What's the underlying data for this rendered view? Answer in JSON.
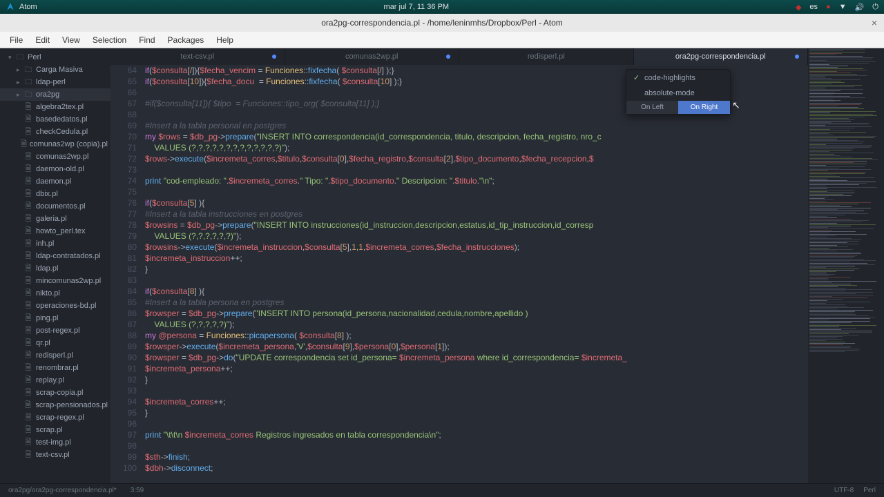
{
  "topbar": {
    "app": "Atom",
    "clock": "mar jul 7, 11 36 PM",
    "lang": "es"
  },
  "titlebar": {
    "text": "ora2pg-correspondencia.pl - /home/leninmhs/Dropbox/Perl - Atom"
  },
  "menu": [
    "File",
    "Edit",
    "View",
    "Selection",
    "Find",
    "Packages",
    "Help"
  ],
  "tree": {
    "root": "Perl",
    "folders": [
      "Carga Masiva",
      "ldap-perl",
      "ora2pg"
    ],
    "files": [
      "algebra2tex.pl",
      "basededatos.pl",
      "checkCedula.pl",
      "comunas2wp (copia).pl",
      "comunas2wp.pl",
      "daemon-old.pl",
      "daemon.pl",
      "dbix.pl",
      "documentos.pl",
      "galeria.pl",
      "howto_perl.tex",
      "inh.pl",
      "ldap-contratados.pl",
      "ldap.pl",
      "mincomunas2wp.pl",
      "nikto.pl",
      "operaciones-bd.pl",
      "ping.pl",
      "post-regex.pl",
      "qr.pl",
      "redisperl.pl",
      "renombrar.pl",
      "replay.pl",
      "scrap-copia.pl",
      "scrap-pensionados.pl",
      "scrap-regex.pl",
      "scrap.pl",
      "test-img.pl",
      "text-csv.pl"
    ]
  },
  "tabs": [
    {
      "name": "text-csv.pl",
      "modified": true
    },
    {
      "name": "comunas2wp.pl",
      "modified": true
    },
    {
      "name": "redisperl.pl",
      "modified": false
    },
    {
      "name": "ora2pg-correspondencia.pl",
      "modified": true,
      "active": true
    }
  ],
  "popup": {
    "opt1": "code-highlights",
    "opt2": "absolute-mode",
    "btnL": "On Left",
    "btnR": "On Right"
  },
  "status": {
    "path": "ora2pg/ora2pg-correspondencia.pl*",
    "pos": "3:59",
    "enc": "UTF-8",
    "lang": "Perl"
  },
  "lines": [
    "64",
    "65",
    "66",
    "67",
    "68",
    "69",
    "70",
    "71",
    "72",
    "73",
    "74",
    "75",
    "76",
    "77",
    "78",
    "79",
    "80",
    "81",
    "82",
    "83",
    "84",
    "85",
    "86",
    "87",
    "88",
    "89",
    "90",
    "91",
    "92",
    "93",
    "94",
    "95",
    "96",
    "97",
    "98",
    "99",
    "100"
  ],
  "chart_data": {
    "type": "code",
    "language": "perl",
    "first_line": 64,
    "rows": [
      "if($consulta[/]){$fecha_vencim = Funciones::fixfecha( $consulta[/] );}",
      "if($consulta[10]){$fecha_docu  = Funciones::fixfecha( $consulta[10] );}",
      "",
      "#if($consulta[11]){ $tipo  = Funciones::tipo_org( $consulta[11] );}",
      "",
      "#Insert a la tabla personal en postgres",
      "my $rows = $db_pg->prepare(\"INSERT INTO correspondencia(id_correspondencia, titulo, descripcion, fecha_registro, nro_c",
      "    VALUES (?,?,?,?,?,?,?,?,?,?,?,?,?)\");",
      "$rows->execute($incremeta_corres,$titulo,$consulta[0],$fecha_registro,$consulta[2],$tipo_documento,$fecha_recepcion,$",
      "",
      "print \"cod-empleado: \".$incremeta_corres.\" Tipo: \".$tipo_documento.\" Descripcion: \".$titulo.\"\\n\";",
      "",
      "if($consulta[5] ){",
      "#Insert a la tabla instrucciones en postgres",
      "$rowsins = $db_pg->prepare(\"INSERT INTO instrucciones(id_instruccion,descripcion,estatus,id_tip_instruccion,id_corresp",
      "    VALUES (?,?,?,?,?,?)\");",
      "$rowsins->execute($incremeta_instruccion,$consulta[5],1,1,$incremeta_corres,$fecha_instrucciones);",
      "$incremeta_instruccion++;",
      "}",
      "",
      "if($consulta[8] ){",
      "#Insert a la tabla persona en postgres",
      "$rowsper = $db_pg->prepare(\"INSERT INTO persona(id_persona,nacionalidad,cedula,nombre,apellido )",
      "    VALUES (?,?,?,?,?)\");",
      "my @persona = Funciones::picapersona( $consulta[8] );",
      "$rowsper->execute($incremeta_persona,'V',$consulta[9],$persona[0],$persona[1]);",
      "$rowsper = $db_pg->do(\"UPDATE correspondencia set id_persona= $incremeta_persona where id_correspondencia= $incremeta_",
      "$incremeta_persona++;",
      "}",
      "",
      "$incremeta_corres++;",
      "}",
      "",
      "print \"\\t\\t\\n $incremeta_corres Registros ingresados en tabla correspondencia\\n\";",
      "",
      "$sth->finish;",
      "$dbh->disconnect;"
    ]
  }
}
